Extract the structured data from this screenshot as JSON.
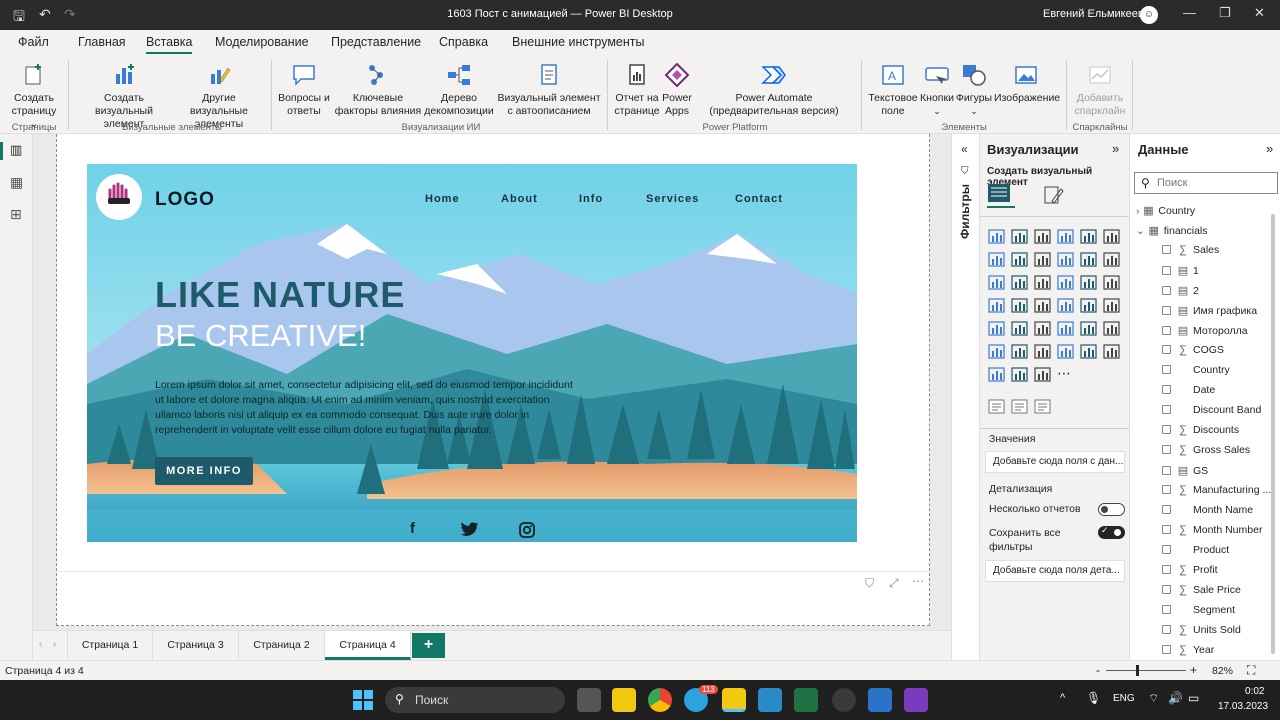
{
  "window": {
    "title": "1603 Пост с анимацией — Power BI Desktop",
    "user": "Евгений Ельмикеев"
  },
  "menu": [
    "Файл",
    "Главная",
    "Вставка",
    "Моделирование",
    "Представление",
    "Справка",
    "Внешние инструменты"
  ],
  "ribbon": {
    "new_page": "Создать страницу",
    "new_page_arrow": "⌄",
    "new_visual": "Создать визуальный элемент",
    "more_visuals": "Другие визуальные элементы",
    "qa": "Вопросы и ответы",
    "key_influencers": "Ключевые факторы влияния",
    "decomp_tree": "Дерево декомпозиции",
    "smart_narrative": "Визуальный элемент с автоописанием",
    "paginated": "Отчет на странице",
    "power_apps": "Power Apps",
    "power_automate": "Power Automate (предварительная версия)",
    "text_box": "Текстовое поле",
    "buttons": "Кнопки",
    "shapes": "Фигуры",
    "image": "Изображение",
    "sparkline": "Добавить спарклайн",
    "groups": [
      "Страницы",
      "Визуальные элементы",
      "Визуализации ИИ",
      "Power Platform",
      "Элементы",
      "Спарклайны"
    ]
  },
  "hero": {
    "logo": "LOGO",
    "nav": [
      "Home",
      "About",
      "Info",
      "Services",
      "Contact"
    ],
    "headline1": "LIKE NATURE",
    "headline2": "BE CREATIVE!",
    "body": "Lorem ipsum dolor sit amet, consectetur adipisicing elit, sed do eiusmod tempor incididunt ut labore et dolore magna aliqua. Ut enim ad minim veniam, quis nostrud exercitation ullamco laboris nisi ut aliquip ex ea commodo consequat. Duis aute irure dolor in reprehenderit in voluptate velit esse cillum dolore eu fugiat nulla pariatur.",
    "cta": "MORE INFO"
  },
  "filters_label": "Фильтры",
  "viz": {
    "title": "Визуализации",
    "build": "Создать визуальный элемент",
    "values_label": "Значения",
    "values_placeholder": "Добавьте сюда поля с дан...",
    "drill_label": "Детализация",
    "multi_reports": "Несколько отчетов",
    "keep_filters": "Сохранить все фильтры",
    "drill_placeholder": "Добавьте сюда поля дета..."
  },
  "data": {
    "title": "Данные",
    "search_placeholder": "Поиск",
    "tables": [
      "Country",
      "financials"
    ],
    "fields": [
      {
        "name": "Sales",
        "icon": "∑"
      },
      {
        "name": "1",
        "icon": "▤"
      },
      {
        "name": "2",
        "icon": "▤"
      },
      {
        "name": "Имя графика",
        "icon": "▤"
      },
      {
        "name": "Моторолла",
        "icon": "▤"
      },
      {
        "name": "COGS",
        "icon": "∑"
      },
      {
        "name": "Country",
        "icon": ""
      },
      {
        "name": "Date",
        "icon": ""
      },
      {
        "name": "Discount Band",
        "icon": ""
      },
      {
        "name": "Discounts",
        "icon": "∑"
      },
      {
        "name": "Gross Sales",
        "icon": "∑"
      },
      {
        "name": "GS",
        "icon": "▤"
      },
      {
        "name": "Manufacturing ...",
        "icon": "∑"
      },
      {
        "name": "Month Name",
        "icon": ""
      },
      {
        "name": "Month Number",
        "icon": "∑"
      },
      {
        "name": "Product",
        "icon": ""
      },
      {
        "name": "Profit",
        "icon": "∑"
      },
      {
        "name": "Sale Price",
        "icon": "∑"
      },
      {
        "name": "Segment",
        "icon": ""
      },
      {
        "name": "Units Sold",
        "icon": "∑"
      },
      {
        "name": "Year",
        "icon": "∑"
      }
    ]
  },
  "tabs": [
    "Страница 1",
    "Страница 3",
    "Страница 2",
    "Страница 4"
  ],
  "add_tab": "+",
  "status": {
    "page": "Страница 4 из 4",
    "zoom": "82%"
  },
  "taskbar": {
    "search": "Поиск",
    "lang": "ENG",
    "time": "0:02",
    "date": "17.03.2023",
    "badge": "113"
  },
  "colors": {
    "accent": "#117865",
    "teal_dark": "#1e5a6a",
    "sky": "#7fd6ea"
  }
}
